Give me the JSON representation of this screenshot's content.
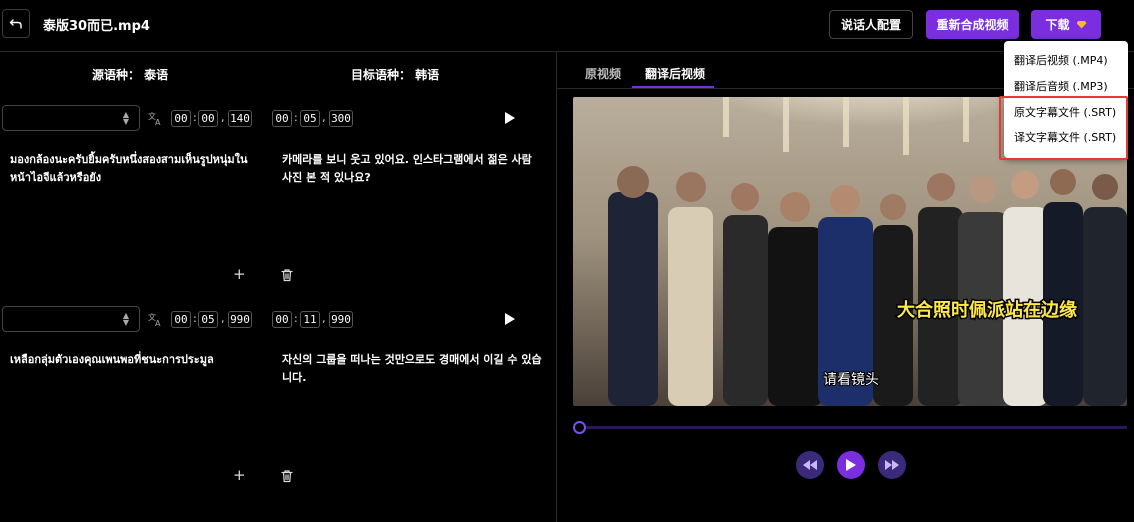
{
  "header": {
    "file_name": "泰版30而已.mp4",
    "speaker_config_label": "说话人配置",
    "resynthesize_label": "重新合成视频",
    "download_label": "下载"
  },
  "download_menu": {
    "items": [
      {
        "label": "翻译后视频 (.MP4)"
      },
      {
        "label": "翻译后音频 (.MP3)"
      },
      {
        "label": "原文字幕文件 (.SRT)"
      },
      {
        "label": "译文字幕文件 (.SRT)"
      }
    ]
  },
  "editor": {
    "source_lang_label": "源语种：  泰语",
    "target_lang_label": "目标语种：  韩语",
    "segments": [
      {
        "start": {
          "hh": "00",
          "mm": "00",
          "ms": "140"
        },
        "end": {
          "hh": "00",
          "mm": "05",
          "ms": "300"
        },
        "source_text": "มองกล้องนะครับยิ้มครับหนึ่งสองสามเห็นรูปหนุ่มในหน้าไอจีแล้วหรือยัง",
        "target_text": "카메라를 보니 웃고 있어요. 인스타그램에서 젊은 사람 사진 본 적 있나요?"
      },
      {
        "start": {
          "hh": "00",
          "mm": "05",
          "ms": "990"
        },
        "end": {
          "hh": "00",
          "mm": "11",
          "ms": "990"
        },
        "source_text": "เหลือกลุ่มตัวเองคุณเพนพอที่ชนะการประมูล",
        "target_text": "자신의 그룹을 떠나는 것만으로도 경매에서 이길 수 있습니다."
      }
    ],
    "time_separator": ":",
    "ms_separator": ",",
    "add_symbol": "+"
  },
  "preview": {
    "tabs": [
      {
        "label": "原视频",
        "active": false
      },
      {
        "label": "翻译后视频",
        "active": true
      }
    ],
    "video": {
      "caption_yellow": "大合照时佩派站在边缘",
      "caption_white": "请看镜头"
    },
    "progress": 0.0
  },
  "colors": {
    "accent": "#7a2ee0",
    "highlight_border": "#e53935",
    "caption_yellow": "#ffe94a"
  }
}
